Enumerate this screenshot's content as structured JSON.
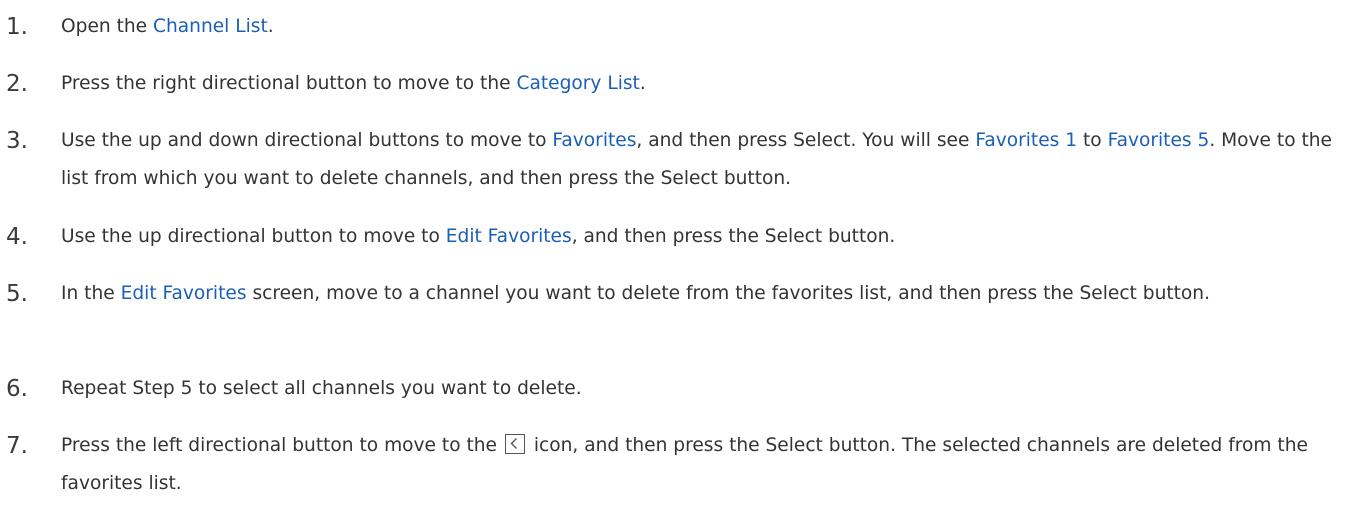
{
  "accent_color": "#1a5fb4",
  "steps": [
    {
      "number": "1.",
      "parts": [
        {
          "t": "Open the "
        },
        {
          "t": "Channel List",
          "link": true
        },
        {
          "t": "."
        }
      ]
    },
    {
      "number": "2.",
      "parts": [
        {
          "t": "Press the right directional button to move to the "
        },
        {
          "t": "Category List",
          "link": true
        },
        {
          "t": "."
        }
      ]
    },
    {
      "number": "3.",
      "parts": [
        {
          "t": "Use the up and down directional buttons to move to "
        },
        {
          "t": "Favorites",
          "link": true
        },
        {
          "t": ", and then press Select. You will see "
        },
        {
          "t": "Favorites 1",
          "link": true
        },
        {
          "t": " to "
        },
        {
          "t": "Favorites 5",
          "link": true
        },
        {
          "t": ". Move to the list from which you want to delete channels, and then press the Select button."
        }
      ]
    },
    {
      "number": "4.",
      "parts": [
        {
          "t": "Use the up directional button to move to "
        },
        {
          "t": "Edit Favorites",
          "link": true
        },
        {
          "t": ", and then press the Select button."
        }
      ]
    },
    {
      "number": "5.",
      "parts": [
        {
          "t": "In the "
        },
        {
          "t": "Edit Favorites",
          "link": true
        },
        {
          "t": " screen, move to a channel you want to delete from the favorites list, and then press the Select button."
        }
      ]
    },
    {
      "number": "6.",
      "parts": [
        {
          "t": "Repeat Step 5 to select all channels you want to delete."
        }
      ]
    },
    {
      "number": "7.",
      "parts": [
        {
          "t": "Press the left directional button to move to the "
        },
        {
          "icon": "back-arrow-icon"
        },
        {
          "t": " icon, and then press the Select button. The selected channels are deleted from the favorites list."
        }
      ]
    }
  ]
}
